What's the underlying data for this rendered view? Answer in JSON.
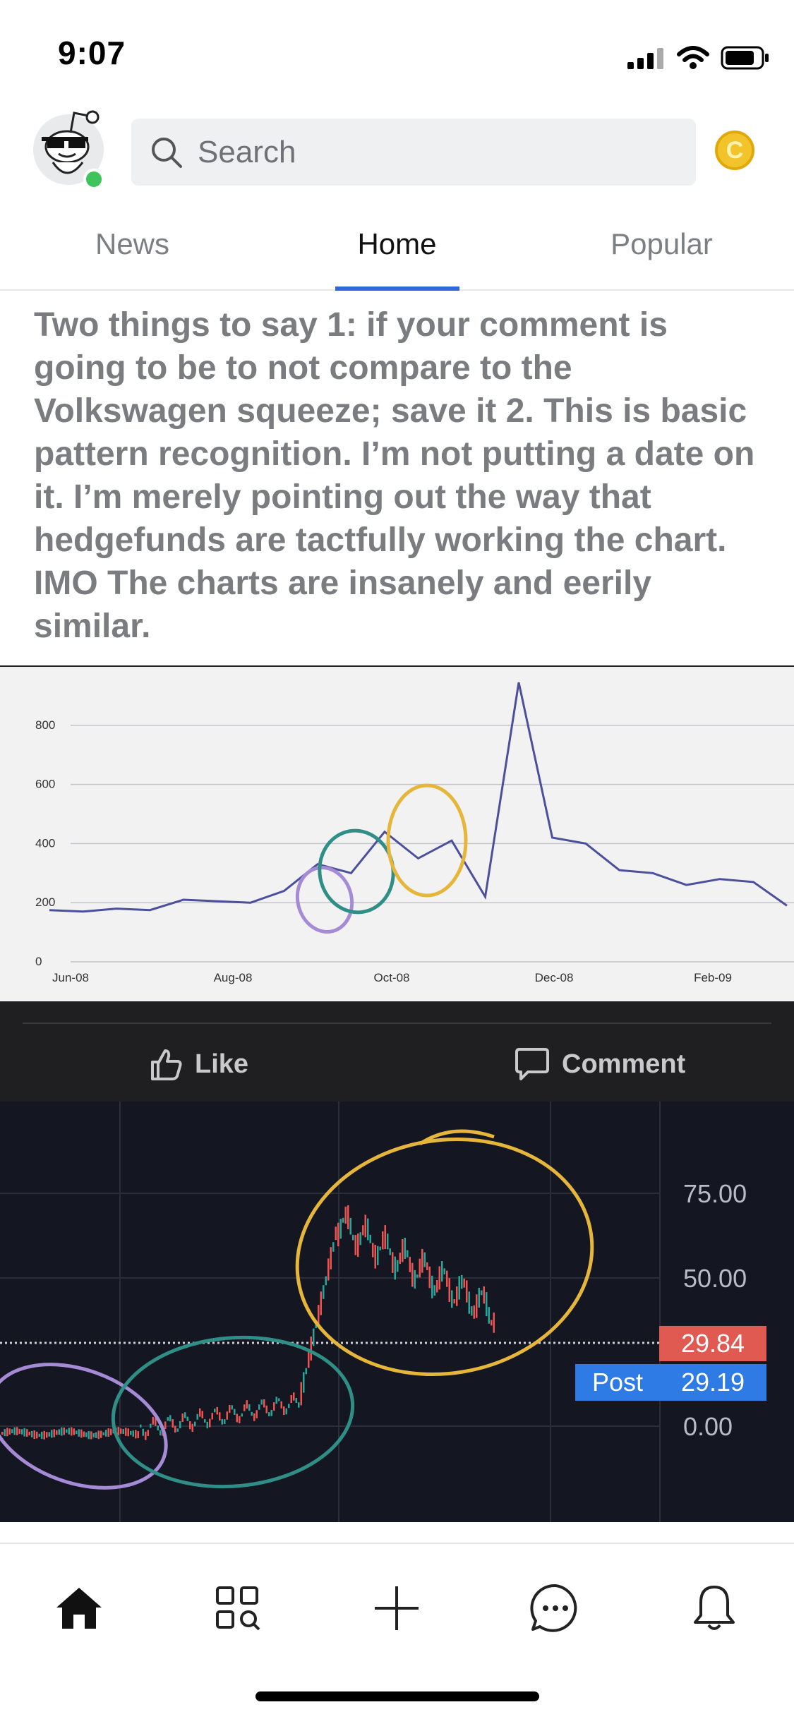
{
  "status_bar": {
    "time": "9:07"
  },
  "search": {
    "placeholder": "Search"
  },
  "tabs": [
    {
      "label": "News",
      "active": false
    },
    {
      "label": "Home",
      "active": true
    },
    {
      "label": "Popular",
      "active": false
    }
  ],
  "post": {
    "text": "Two things to say 1: if your comment is going to be to not compare to the Volkswagen squeeze; save it 2. This is basic pattern recognition. I’m not putting a date on it. I’m merely pointing out the way that hedgefunds are tactfully working the chart. IMO The charts are insanely and eerily similar."
  },
  "actions": {
    "like_label": "Like",
    "comment_label": "Comment"
  },
  "chart_data": [
    {
      "type": "line",
      "x_ticks": [
        "Jun-08",
        "Aug-08",
        "Oct-08",
        "Dec-08",
        "Feb-09"
      ],
      "y_ticks": [
        0,
        200,
        400,
        600,
        800
      ],
      "ylim": [
        0,
        950
      ],
      "grid": true,
      "series": [
        {
          "color": "#4b4f9c",
          "points": [
            [
              "Jun-08",
              175
            ],
            [
              "Jun-08+",
              170
            ],
            [
              "Jul-08",
              180
            ],
            [
              "Jul-08+",
              175
            ],
            [
              "Aug-08",
              210
            ],
            [
              "Aug-08+",
              205
            ],
            [
              "Sep-08",
              200
            ],
            [
              "Sep-08+",
              240
            ],
            [
              "Sep-08+2",
              330
            ],
            [
              "Oct-08",
              300
            ],
            [
              "Oct-08+",
              440
            ],
            [
              "Oct-08+2",
              350
            ],
            [
              "Oct-08+3",
              410
            ],
            [
              "Oct-08+4",
              220
            ],
            [
              "Oct-08+5",
              945
            ],
            [
              "Nov-08",
              420
            ],
            [
              "Nov-08+",
              400
            ],
            [
              "Dec-08",
              310
            ],
            [
              "Dec-08+",
              300
            ],
            [
              "Jan-09",
              260
            ],
            [
              "Jan-09+",
              280
            ],
            [
              "Feb-09",
              270
            ],
            [
              "Feb-09+",
              190
            ]
          ]
        }
      ],
      "annotations_colors": [
        "#a58bd6",
        "#2f8f86",
        "#e6b63b"
      ]
    },
    {
      "type": "candlestick",
      "y_ticks": [
        "75.00",
        "50.00",
        "0.00"
      ],
      "last_price_label": "29.84",
      "post_label": "Post",
      "post_price_label": "29.19",
      "colors": {
        "up": "#26a69a",
        "down": "#ef5350",
        "post": "#2f7be6"
      },
      "annotations_colors": [
        "#a58bd6",
        "#2f8f86",
        "#e6b63b"
      ]
    }
  ]
}
